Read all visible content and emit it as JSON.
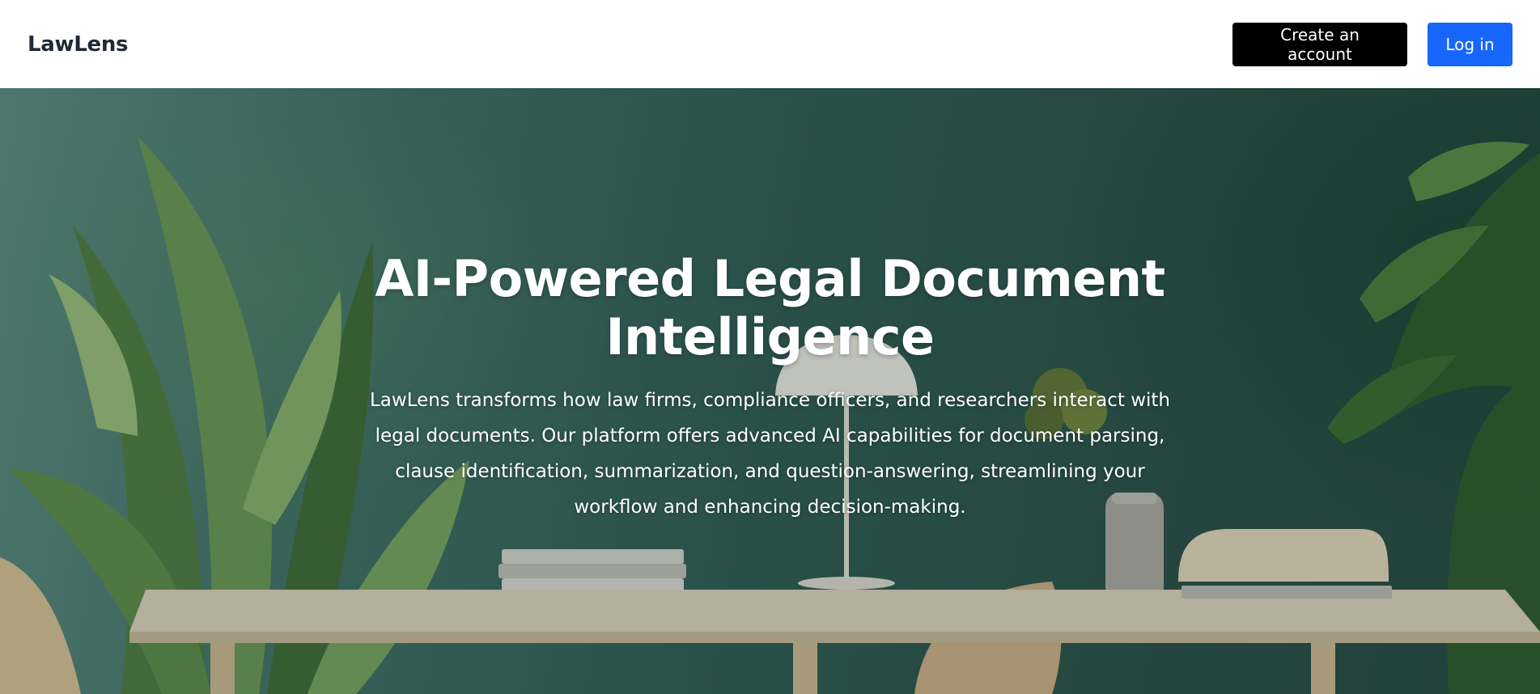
{
  "header": {
    "brand": "LawLens",
    "create_account_label": "Create an account",
    "login_label": "Log in"
  },
  "hero": {
    "title": "AI-Powered Legal Document Intelligence",
    "description": "LawLens transforms how law firms, compliance officers, and researchers interact with legal documents. Our platform offers advanced AI capabilities for document parsing, clause identification, summarization, and question-answering, streamlining your workflow and enhancing decision-making."
  },
  "colors": {
    "brand_text": "#1f2937",
    "dark_button": "#000000",
    "primary_button": "#1766ff",
    "hero_wall": "#2f5a51"
  },
  "icons": {
    "hero_background": "office-desk-with-plants"
  }
}
